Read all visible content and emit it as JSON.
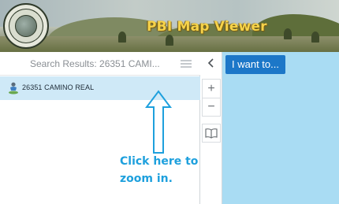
{
  "header": {
    "title": "PBI Map Viewer",
    "logo_icon": "county-seal-icon"
  },
  "results": {
    "title": "Search Results: 26351 CAMI...",
    "items": [
      {
        "label": "26351 CAMINO REAL",
        "icon": "map-marker-person-icon"
      }
    ],
    "selected_color": "#cfe9f7"
  },
  "toolbar": {
    "collapse_icon": "chevron-left-icon",
    "zoom_in_label": "+",
    "zoom_out_label": "−",
    "bookmarks_icon": "book-icon"
  },
  "map": {
    "i_want_to_label": "I want to...",
    "background_color": "#a9dcf3",
    "accent_color": "#1c77c8"
  },
  "annotation": {
    "line1": "Click here to",
    "line2": "zoom in.",
    "color": "#1ea0dd"
  }
}
